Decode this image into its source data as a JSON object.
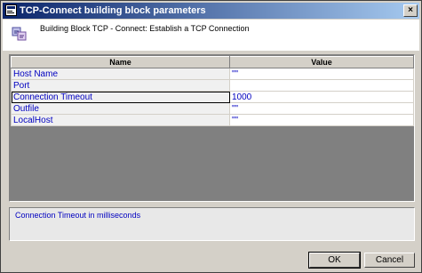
{
  "window": {
    "title": "TCP-Connect building block parameters",
    "close_label": "×"
  },
  "header": {
    "description": "Building Block TCP - Connect: Establish a TCP Connection"
  },
  "grid": {
    "columns": {
      "name": "Name",
      "value": "Value"
    },
    "rows": [
      {
        "name": "Host Name",
        "value": "\"\""
      },
      {
        "name": "Port",
        "value": ""
      },
      {
        "name": "Connection Timeout",
        "value": "1000"
      },
      {
        "name": "Outfile",
        "value": "\"\""
      },
      {
        "name": "LocalHost",
        "value": "\"\""
      }
    ],
    "selected_row": 2
  },
  "description_panel": {
    "text": "Connection Timeout in milliseconds"
  },
  "buttons": {
    "ok": "OK",
    "cancel": "Cancel"
  },
  "colors": {
    "title_start": "#0a246a",
    "title_end": "#a6caf0",
    "param_text": "#0000c0",
    "dialog_bg": "#d4d0c8"
  }
}
